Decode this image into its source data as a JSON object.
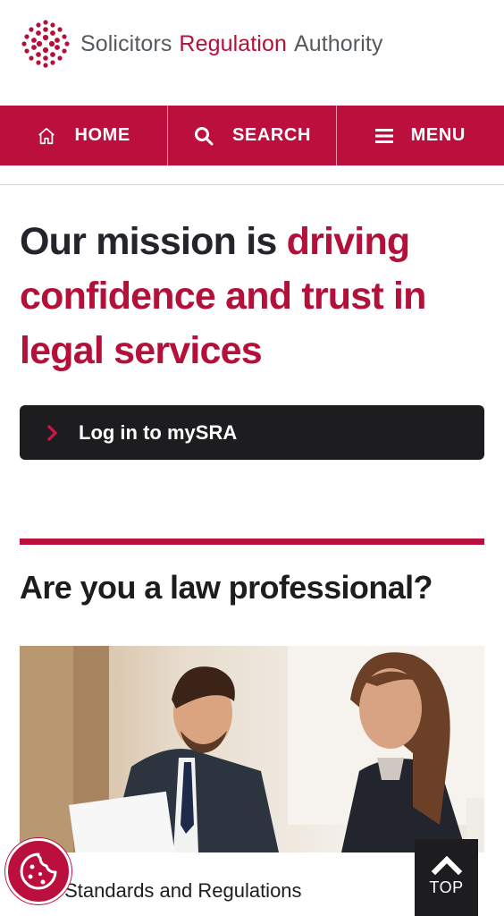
{
  "header": {
    "logo_word1": "Solicitors",
    "logo_word2": "Regulation",
    "logo_word3": "Authority"
  },
  "nav": {
    "home_label": "HOME",
    "search_label": "SEARCH",
    "menu_label": "MENU"
  },
  "hero": {
    "mission_prefix": "Our mission is ",
    "mission_highlight": "driving confidence and trust in legal services",
    "login_label": "Log in to mySRA"
  },
  "section": {
    "title": "Are you a law professional?",
    "card_label": "SRA Standards and Regulations"
  },
  "floating": {
    "top_label": "TOP"
  },
  "colors": {
    "brand_red": "#bb0f3d",
    "dark": "#1d1d1f",
    "logo_grey": "#555a5f"
  },
  "icons": {
    "home": "home-icon",
    "search": "search-icon",
    "menu": "hamburger-icon",
    "login": "chevron-right-icon",
    "cookie": "cookie-icon",
    "top": "chevron-up-icon"
  }
}
